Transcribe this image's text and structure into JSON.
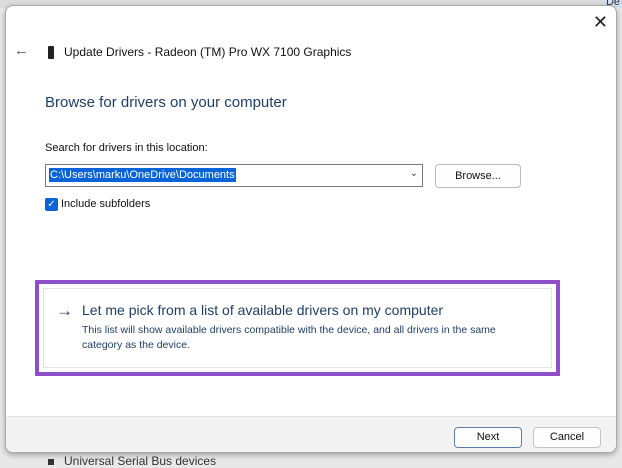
{
  "background": {
    "top_right_text": "De",
    "bottom_text": "Universal Serial Bus devices"
  },
  "dialog": {
    "title": "Update Drivers - Radeon (TM) Pro WX 7100 Graphics",
    "heading": "Browse for drivers on your computer",
    "search_label": "Search for drivers in this location:",
    "path_value": "C:\\Users\\marku\\OneDrive\\Documents",
    "browse_label": "Browse...",
    "include_subfolders_label": "Include subfolders",
    "include_subfolders_checked": true,
    "option_title": "Let me pick from a list of available drivers on my computer",
    "option_desc": "This list will show available drivers compatible with the device, and all drivers in the same category as the device.",
    "next_label": "Next",
    "cancel_label": "Cancel",
    "highlight_color": "#8e4fc8"
  }
}
